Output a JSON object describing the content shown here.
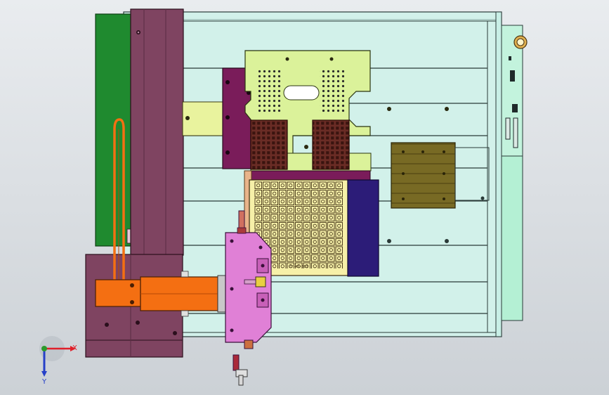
{
  "view": {
    "background_top": "#e9ecef",
    "background_bottom": "#ccd1d6"
  },
  "colors": {
    "base_plate": "#d2f1ea",
    "side_rail": "#b4f0d4",
    "green_board": "#1f8a2f",
    "purple_column": "#7f4461",
    "yellow_plate": "#dbf29a",
    "magenta_block": "#7a1c5a",
    "brown_tray": "#6a2c25",
    "orange_grid_tray": "#f6f0a8",
    "navy_plate": "#2c1c78",
    "olive_block": "#786a24",
    "pink_head": "#e080d6",
    "orange_arm": "#f46f12"
  },
  "triad": {
    "x_label": "X",
    "y_label": "Y",
    "x_color": "#e0202a",
    "y_color": "#2b9a2b",
    "z_color": "#2640c8"
  },
  "engraving": {
    "tray_label": "ZY-43-B03"
  }
}
